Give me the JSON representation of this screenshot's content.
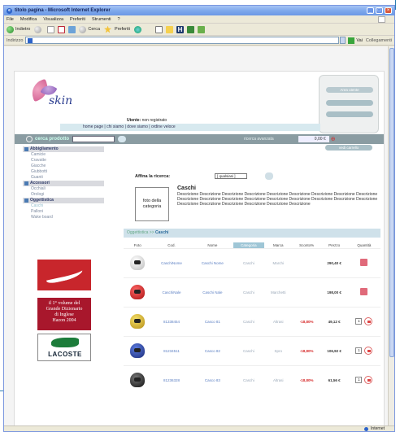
{
  "window": {
    "title": "titolo pagina - Microsoft Internet Explorer"
  },
  "menu": [
    "File",
    "Modifica",
    "Visualizza",
    "Preferiti",
    "Strumenti",
    "?"
  ],
  "toolbar": {
    "back": "Indietro",
    "search": "Cerca",
    "favorites": "Preferiti"
  },
  "address": {
    "label": "Indirizzo",
    "go": "Vai",
    "links": "Collegamenti"
  },
  "site": {
    "logo": "skin",
    "user_label": "Utente:",
    "user_value": "non registrato",
    "nav": "home page | chi siamo | dove siamo | ordine veloce",
    "cart_buttons": [
      "Area utente",
      "vedi carrello"
    ],
    "search_label": "cerca prodotto",
    "advanced": "ricerca avanzata",
    "cart_total": "0,00 €"
  },
  "sidebar": {
    "groups": [
      {
        "title": "Abbigliamento",
        "items": [
          "Camicie",
          "Cravatte",
          "Giacche",
          "Giubbotti",
          "Guanti"
        ]
      },
      {
        "title": "Accessori",
        "items": [
          "Occhiali",
          "Orologi"
        ]
      },
      {
        "title": "Oggettistica",
        "items": [
          "Caschi",
          "Palloni",
          "Wake board"
        ]
      }
    ],
    "dict_banner": [
      "il 1° volume del",
      "Grande Dizionario",
      "di Inglese",
      "Hazon 2004"
    ],
    "lacoste": "LACOSTE"
  },
  "refine": {
    "label": "Affina la ricerca:",
    "select": "[ qualsiasi ]"
  },
  "category": {
    "photo_label": "foto della categoria",
    "title": "Caschi",
    "desc": "Descrizione Descrizione Descrizione Descrizione Descrizione Descrizione Descrizione Descrizione Descrizione Descrizione Descrizione Descrizione Descrizione Descrizione Descrizione Descrizione Descrizione Descrizione Descrizione Descrizione Descrizione Descrizione Descrizione Descrizione"
  },
  "crumb": {
    "path": "Oggettistica >> ",
    "current": "Caschi"
  },
  "table": {
    "headers": [
      "Foto",
      "Cod.",
      "Nome",
      "Categoria",
      "Marca",
      "Sconto%",
      "Prezzo",
      "Quantità"
    ],
    "rows": [
      {
        "helmet": "white",
        "cod": "CaschiNome",
        "nome": "Caschi Nome",
        "cat": "Caschi",
        "marca": "Marchi",
        "sconto": "",
        "prezzo": "290,40 €",
        "qty": ""
      },
      {
        "helmet": "red",
        "cod": "CaschiNale",
        "nome": "Caschi Nale",
        "cat": "Caschi",
        "marca": "Marchetti",
        "sconto": "",
        "prezzo": "198,00 €",
        "qty": ""
      },
      {
        "helmet": "yellow",
        "cod": "81338454",
        "nome": "Casco 81",
        "cat": "Caschi",
        "marca": "Altrasi",
        "sconto": "-18,80%",
        "prezzo": "49,12 €",
        "qty": "1"
      },
      {
        "helmet": "blue",
        "cod": "81234511",
        "nome": "Casco 82",
        "cat": "Caschi",
        "marca": "Spro",
        "sconto": "-18,80%",
        "prezzo": "106,92 €",
        "qty": "1"
      },
      {
        "helmet": "black",
        "cod": "81236328",
        "nome": "Casco 83",
        "cat": "Caschi",
        "marca": "Altrasi",
        "sconto": "-18,80%",
        "prezzo": "61,56 €",
        "qty": "1"
      }
    ]
  },
  "status": {
    "zone": "Internet"
  }
}
